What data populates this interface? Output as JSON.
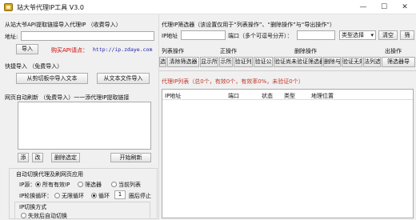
{
  "window": {
    "title": "站大爷代理IP工具 V3.0",
    "minimize": "—",
    "maximize": "☐",
    "close": "✕"
  },
  "left": {
    "import_title": "从站大爷API提取链接导入代理IP （收费导入）",
    "address_label": "地址:",
    "address_value": "",
    "import_button": "导入",
    "purchase_label": "购买API请点：",
    "purchase_link": "http://ip.zdaye.com",
    "quick_title": "快捷导入 （免费导入）",
    "clipboard_button": "从剪切板中导入文本",
    "textfile_button": "从文本文件导入",
    "auto_title": "网页自动刷新 （免费导入）一一添代理IP提取链接",
    "add_button": "添",
    "edit_button": "改",
    "delete_button": "删除选定",
    "start_button": "开始刷新",
    "switch_title": "自动切换代理及刷网页应用",
    "ip_source_label": "IP源：",
    "ip_source_options": [
      "所有有效IP",
      "筛选器",
      "当前列表"
    ],
    "cycle_label": "IP轮换循环：",
    "cycle_options": [
      "无限循环",
      "循环"
    ],
    "cycle_count": "1",
    "cycle_suffix": "圈后停止",
    "switch_mode_label": "IP切换方式",
    "switch_mode_option": "失效后自动切换"
  },
  "right": {
    "filter_title": "代理IP筛选器（该设置仅用于“列表操作”、“删除操作”与“导出操作”）",
    "ip_label": "IP地址",
    "port_label": "端口（多个可逗号分开）：",
    "type_select": "类型选择",
    "clear_button": "清空",
    "filter_button": "筛",
    "ops_headers": [
      "列表操作",
      "正操作",
      "删除操作",
      "出操作"
    ],
    "ops_buttons": [
      "选",
      "清除筛选器",
      "显示所",
      "示所",
      "验证列",
      "验证公",
      "验证尚未验证筛选器",
      "删除与",
      "验证无效",
      "法列选",
      "筛选器导"
    ],
    "list_status": "代理IP列表（总0个，有效0个，有效率0%，未验证0个）",
    "columns": [
      "IP地址",
      "端口",
      "状态",
      "类型",
      "地理位置"
    ]
  }
}
